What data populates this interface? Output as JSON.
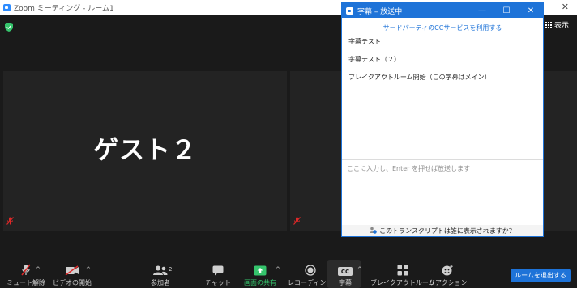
{
  "window": {
    "title": "Zoom ミーティング - ルーム1"
  },
  "meeting": {
    "view_label": "表示",
    "tiles": [
      {
        "name": "ゲスト２"
      },
      {
        "name": ""
      }
    ]
  },
  "captions_window": {
    "title": "字幕 – 放送中",
    "third_party_link": "サードパーティのCCサービスを利用する",
    "lines": [
      "字幕テスト",
      "字幕テスト（２）",
      "ブレイクアウトルーム開始（この字幕はメイン）"
    ],
    "input_placeholder": "ここに入力し、Enter を押せば放送します",
    "footer_question": "このトランスクリプトは誰に表示されますか？"
  },
  "toolbar": {
    "unmute": "ミュート解除",
    "start_video": "ビデオの開始",
    "participants": "参加者",
    "participants_count": "2",
    "chat": "チャット",
    "share_screen": "画面の共有",
    "recording": "レコーディング",
    "captions": "字幕",
    "captions_badge": "CC",
    "breakout_rooms": "ブレイクアウトルーム",
    "reactions": "リアクション",
    "leave_room": "ルームを退出する"
  },
  "colors": {
    "accent": "#1e73d8",
    "share_green": "#35c46c",
    "mute_red": "#e02828",
    "shield_green": "#35c46c"
  }
}
